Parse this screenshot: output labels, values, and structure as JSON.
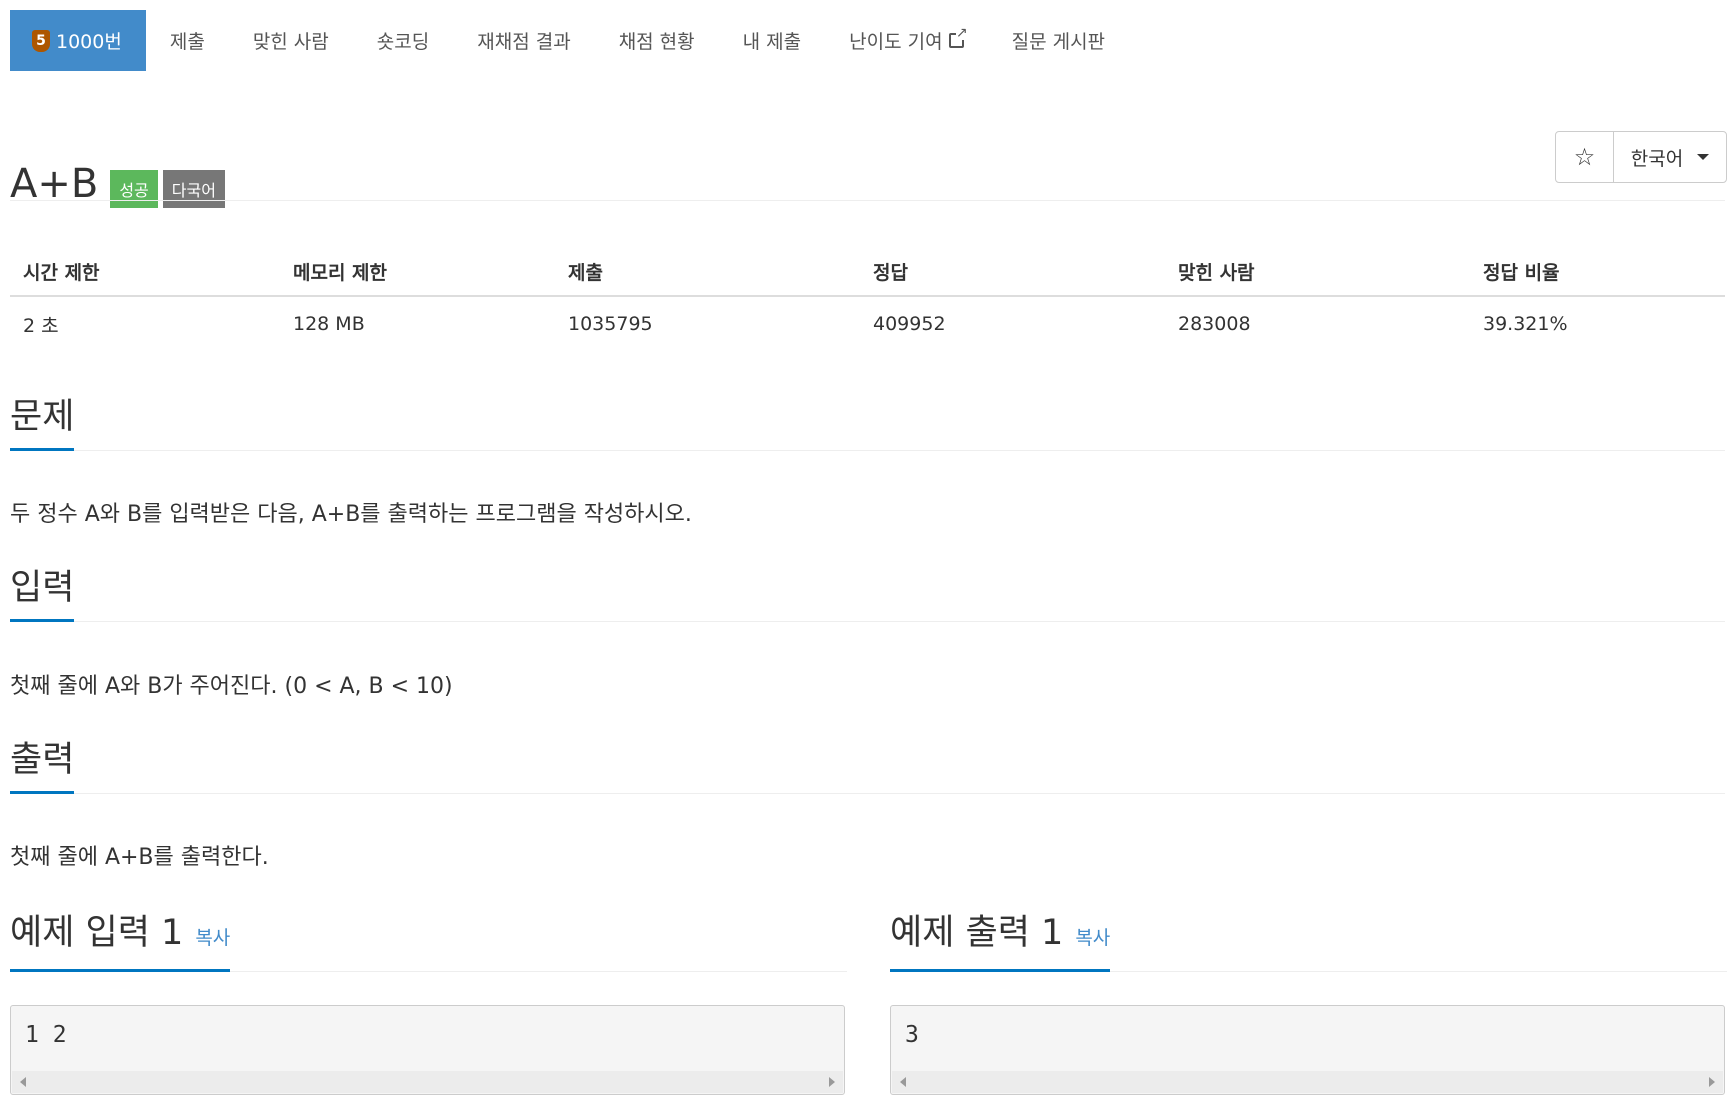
{
  "nav": {
    "tier_badge": "5",
    "tabs": [
      {
        "label": "1000번"
      },
      {
        "label": "제출"
      },
      {
        "label": "맞힌 사람"
      },
      {
        "label": "숏코딩"
      },
      {
        "label": "재채점 결과"
      },
      {
        "label": "채점 현황"
      },
      {
        "label": "내 제출"
      },
      {
        "label": "난이도 기여"
      },
      {
        "label": "질문 게시판"
      }
    ]
  },
  "problem": {
    "title": "A+B",
    "badges": {
      "status": "성공",
      "language": "다국어"
    },
    "star_icon": "☆",
    "language_select": "한국어"
  },
  "info": {
    "headers": [
      "시간 제한",
      "메모리 제한",
      "제출",
      "정답",
      "맞힌 사람",
      "정답 비율"
    ],
    "values": [
      "2 초",
      "128 MB",
      "1035795",
      "409952",
      "283008",
      "39.321%"
    ]
  },
  "sections": {
    "problem": {
      "heading": "문제",
      "text": "두 정수 A와 B를 입력받은 다음, A+B를 출력하는 프로그램을 작성하시오."
    },
    "input": {
      "heading": "입력",
      "text": "첫째 줄에 A와 B가 주어진다. (0 < A, B < 10)"
    },
    "output": {
      "heading": "출력",
      "text": "첫째 줄에 A+B를 출력한다."
    }
  },
  "samples": {
    "input": {
      "heading": "예제 입력 1",
      "copy": "복사",
      "content": "1 2"
    },
    "output": {
      "heading": "예제 출력 1",
      "copy": "복사",
      "content": "3"
    }
  }
}
